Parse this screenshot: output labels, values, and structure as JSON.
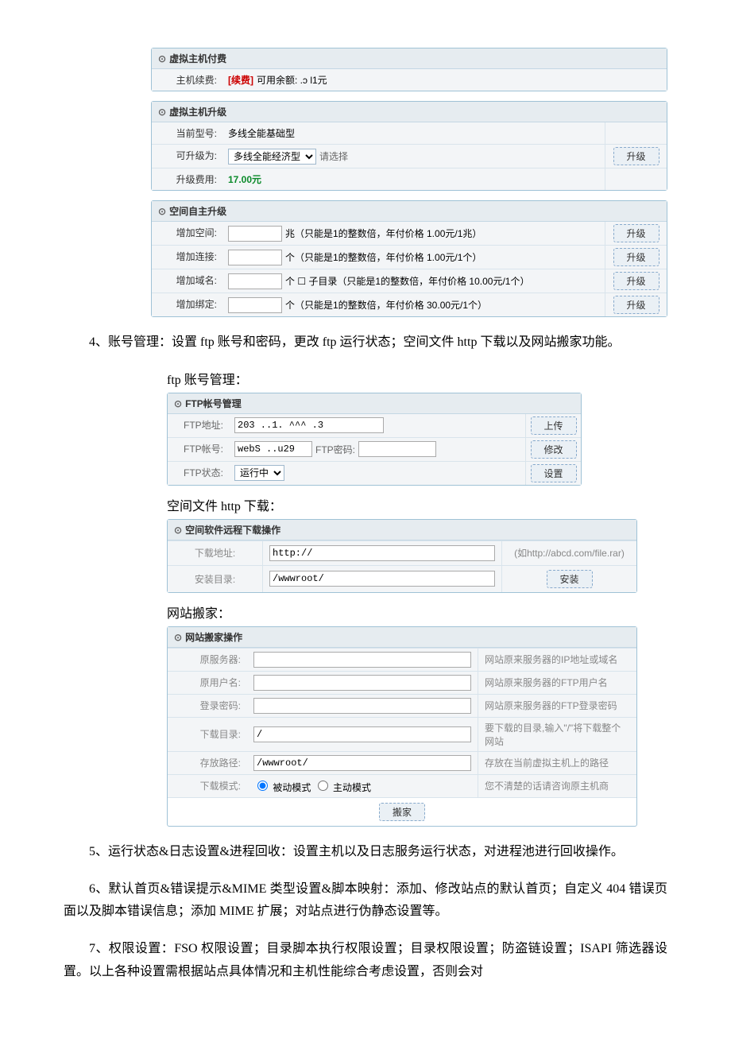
{
  "pay": {
    "title": "虚拟主机付费",
    "renew_label": "主机续费:",
    "renew_action": "[续费]",
    "balance_text": "可用余额: .ɔ l1元"
  },
  "upgrade": {
    "title": "虚拟主机升级",
    "current_label": "当前型号:",
    "current_value": "多线全能基础型",
    "target_label": "可升级为:",
    "target_option": "多线全能经济型",
    "target_hint": "请选择",
    "fee_label": "升级费用:",
    "fee_value": "17.00元",
    "btn": "升级"
  },
  "space": {
    "title": "空间自主升级",
    "rows": [
      {
        "label": "增加空间:",
        "suffix": "兆（只能是1的整数倍，年付价格 1.00元/1兆）",
        "btn": "升级"
      },
      {
        "label": "增加连接:",
        "suffix": "个（只能是1的整数倍，年付价格 1.00元/1个）",
        "btn": "升级"
      },
      {
        "label": "增加域名:",
        "suffix": "个 ☐ 子目录（只能是1的整数倍，年付价格 10.00元/1个）",
        "btn": "升级"
      },
      {
        "label": "增加绑定:",
        "suffix": "个（只能是1的整数倍，年付价格 30.00元/1个）",
        "btn": "升级"
      }
    ]
  },
  "para4": "4、账号管理：设置 ftp 账号和密码，更改 ftp 运行状态；空间文件 http 下载以及网站搬家功能。",
  "ftp": {
    "caption": "ftp 账号管理：",
    "title": "FTP帐号管理",
    "addr_label": "FTP地址:",
    "addr_value": "203 ..1. ^^^ .3",
    "addr_btn": "上传",
    "acct_label": "FTP帐号:",
    "acct_value": "webS ..u29",
    "pwd_label": "FTP密码:",
    "acct_btn": "修改",
    "state_label": "FTP状态:",
    "state_option": "运行中",
    "state_btn": "设置"
  },
  "download": {
    "caption": "空间文件 http 下载：",
    "title": "空间软件远程下载操作",
    "url_label": "下载地址:",
    "url_value": "http://",
    "url_hint": "(如http://abcd.com/file.rar)",
    "dir_label": "安装目录:",
    "dir_value": "/wwwroot/",
    "dir_btn": "安装"
  },
  "move": {
    "caption": "网站搬家：",
    "title": "网站搬家操作",
    "rows": [
      {
        "label": "原服务器:",
        "value": "",
        "hint": "网站原来服务器的IP地址或域名"
      },
      {
        "label": "原用户名:",
        "value": "",
        "hint": "网站原来服务器的FTP用户名"
      },
      {
        "label": "登录密码:",
        "value": "",
        "hint": "网站原来服务器的FTP登录密码"
      },
      {
        "label": "下载目录:",
        "value": "/",
        "hint": "要下载的目录,输入\"/\"将下载整个网站"
      },
      {
        "label": "存放路径:",
        "value": "/wwwroot/",
        "hint": "存放在当前虚拟主机上的路径"
      }
    ],
    "mode_label": "下载模式:",
    "mode_passive": "被动模式",
    "mode_active": "主动模式",
    "mode_hint": "您不清楚的话请咨询原主机商",
    "btn": "搬家"
  },
  "para5": "5、运行状态&日志设置&进程回收：设置主机以及日志服务运行状态，对进程池进行回收操作。",
  "para6": "6、默认首页&错误提示&MIME 类型设置&脚本映射：添加、修改站点的默认首页；自定义 404 错误页面以及脚本错误信息；添加 MIME 扩展；对站点进行伪静态设置等。",
  "para7": "7、权限设置：FSO 权限设置；目录脚本执行权限设置；目录权限设置；防盗链设置；ISAPI 筛选器设置。以上各种设置需根据站点具体情况和主机性能综合考虑设置，否则会对"
}
